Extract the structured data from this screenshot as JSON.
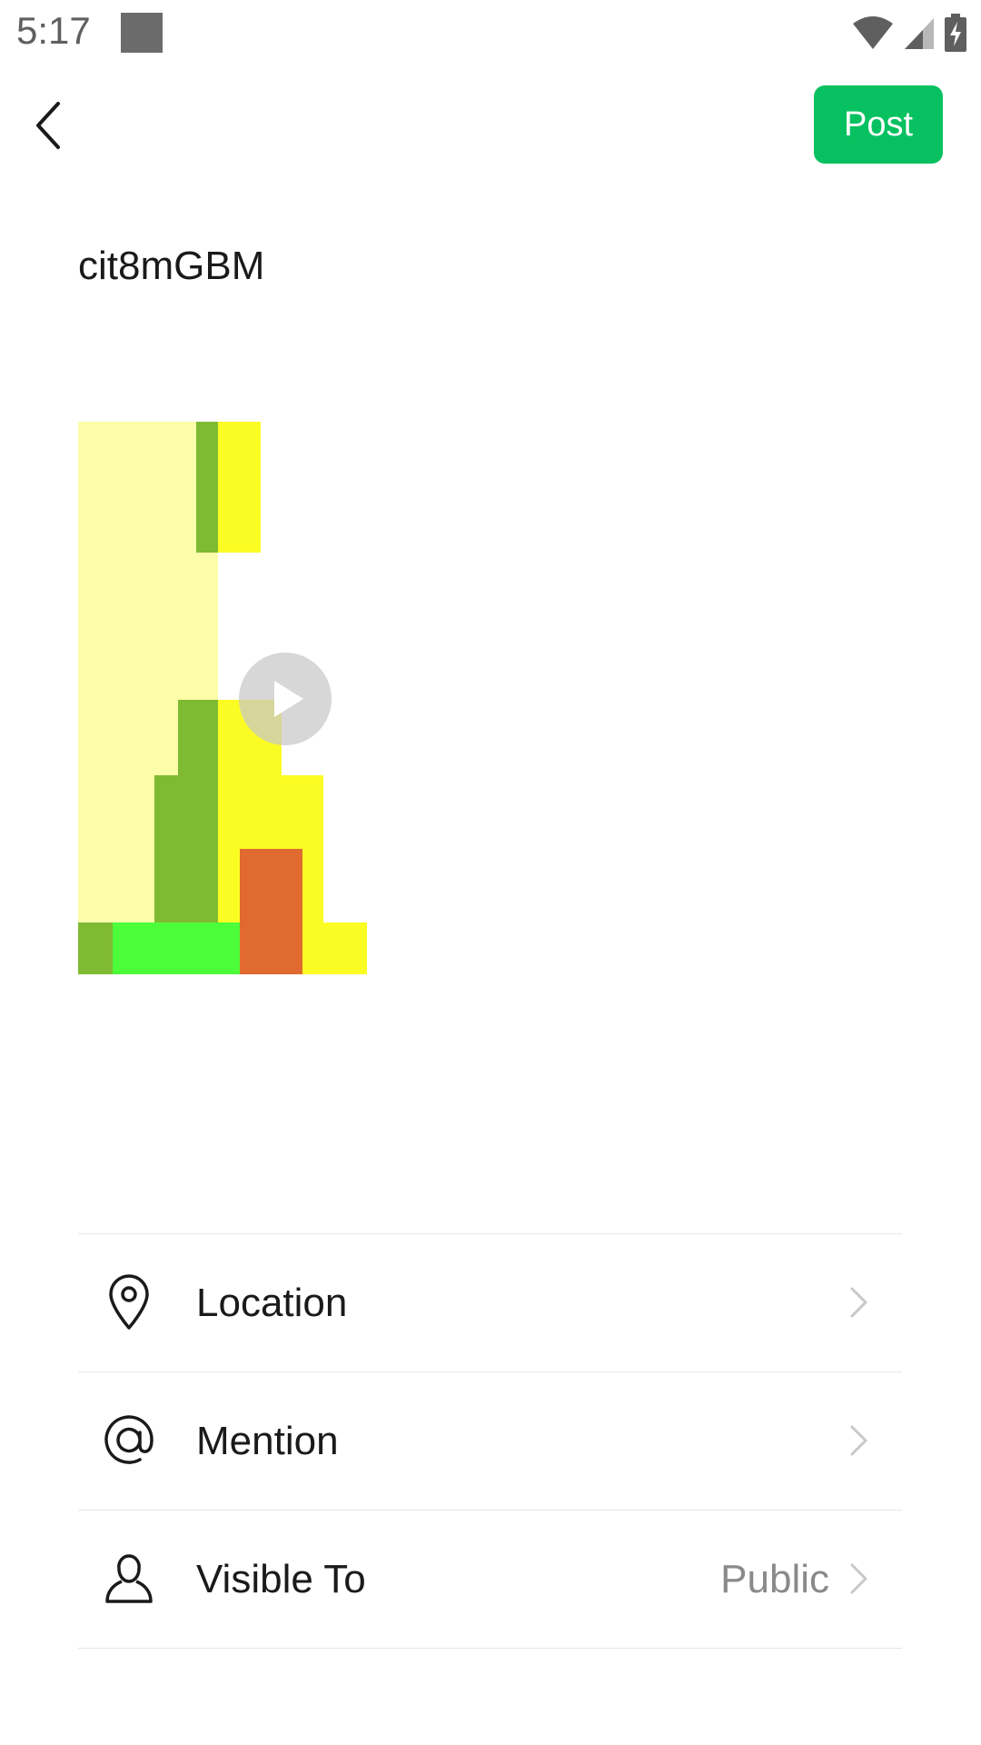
{
  "status_bar": {
    "time": "5:17",
    "icons": [
      "notification-placeholder",
      "wifi-icon",
      "signal-icon",
      "battery-charging-icon"
    ]
  },
  "header": {
    "back_icon": "chevron-left-icon",
    "post_label": "Post",
    "post_color": "#07c160"
  },
  "post": {
    "text": "cit8mGBM",
    "media": {
      "type": "video",
      "play_icon": "play-icon"
    }
  },
  "options": [
    {
      "icon": "location-pin-icon",
      "label": "Location",
      "value": ""
    },
    {
      "icon": "at-sign-icon",
      "label": "Mention",
      "value": ""
    },
    {
      "icon": "person-icon",
      "label": "Visible To",
      "value": "Public"
    }
  ]
}
